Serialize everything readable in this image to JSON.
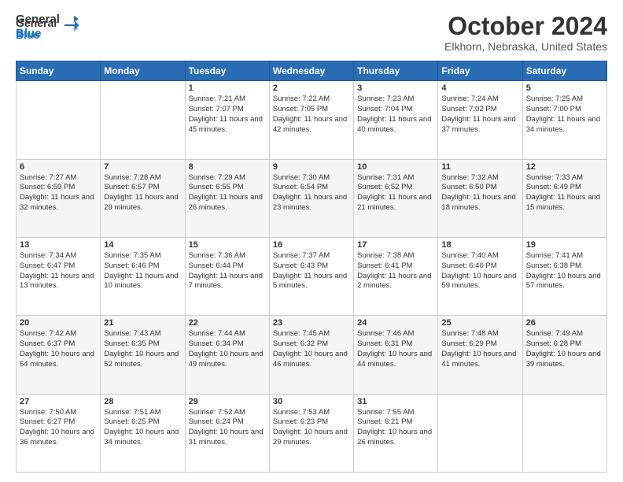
{
  "logo": {
    "line1": "General",
    "line2": "Blue"
  },
  "header": {
    "month": "October 2024",
    "location": "Elkhorn, Nebraska, United States"
  },
  "columns": [
    "Sunday",
    "Monday",
    "Tuesday",
    "Wednesday",
    "Thursday",
    "Friday",
    "Saturday"
  ],
  "weeks": [
    [
      {
        "day": "",
        "sunrise": "",
        "sunset": "",
        "daylight": ""
      },
      {
        "day": "",
        "sunrise": "",
        "sunset": "",
        "daylight": ""
      },
      {
        "day": "1",
        "sunrise": "Sunrise: 7:21 AM",
        "sunset": "Sunset: 7:07 PM",
        "daylight": "Daylight: 11 hours and 45 minutes."
      },
      {
        "day": "2",
        "sunrise": "Sunrise: 7:22 AM",
        "sunset": "Sunset: 7:05 PM",
        "daylight": "Daylight: 11 hours and 42 minutes."
      },
      {
        "day": "3",
        "sunrise": "Sunrise: 7:23 AM",
        "sunset": "Sunset: 7:04 PM",
        "daylight": "Daylight: 11 hours and 40 minutes."
      },
      {
        "day": "4",
        "sunrise": "Sunrise: 7:24 AM",
        "sunset": "Sunset: 7:02 PM",
        "daylight": "Daylight: 11 hours and 37 minutes."
      },
      {
        "day": "5",
        "sunrise": "Sunrise: 7:25 AM",
        "sunset": "Sunset: 7:00 PM",
        "daylight": "Daylight: 11 hours and 34 minutes."
      }
    ],
    [
      {
        "day": "6",
        "sunrise": "Sunrise: 7:27 AM",
        "sunset": "Sunset: 6:59 PM",
        "daylight": "Daylight: 11 hours and 32 minutes."
      },
      {
        "day": "7",
        "sunrise": "Sunrise: 7:28 AM",
        "sunset": "Sunset: 6:57 PM",
        "daylight": "Daylight: 11 hours and 29 minutes."
      },
      {
        "day": "8",
        "sunrise": "Sunrise: 7:29 AM",
        "sunset": "Sunset: 6:55 PM",
        "daylight": "Daylight: 11 hours and 26 minutes."
      },
      {
        "day": "9",
        "sunrise": "Sunrise: 7:30 AM",
        "sunset": "Sunset: 6:54 PM",
        "daylight": "Daylight: 11 hours and 23 minutes."
      },
      {
        "day": "10",
        "sunrise": "Sunrise: 7:31 AM",
        "sunset": "Sunset: 6:52 PM",
        "daylight": "Daylight: 11 hours and 21 minutes."
      },
      {
        "day": "11",
        "sunrise": "Sunrise: 7:32 AM",
        "sunset": "Sunset: 6:50 PM",
        "daylight": "Daylight: 11 hours and 18 minutes."
      },
      {
        "day": "12",
        "sunrise": "Sunrise: 7:33 AM",
        "sunset": "Sunset: 6:49 PM",
        "daylight": "Daylight: 11 hours and 15 minutes."
      }
    ],
    [
      {
        "day": "13",
        "sunrise": "Sunrise: 7:34 AM",
        "sunset": "Sunset: 6:47 PM",
        "daylight": "Daylight: 11 hours and 13 minutes."
      },
      {
        "day": "14",
        "sunrise": "Sunrise: 7:35 AM",
        "sunset": "Sunset: 6:46 PM",
        "daylight": "Daylight: 11 hours and 10 minutes."
      },
      {
        "day": "15",
        "sunrise": "Sunrise: 7:36 AM",
        "sunset": "Sunset: 6:44 PM",
        "daylight": "Daylight: 11 hours and 7 minutes."
      },
      {
        "day": "16",
        "sunrise": "Sunrise: 7:37 AM",
        "sunset": "Sunset: 6:43 PM",
        "daylight": "Daylight: 11 hours and 5 minutes."
      },
      {
        "day": "17",
        "sunrise": "Sunrise: 7:38 AM",
        "sunset": "Sunset: 6:41 PM",
        "daylight": "Daylight: 11 hours and 2 minutes."
      },
      {
        "day": "18",
        "sunrise": "Sunrise: 7:40 AM",
        "sunset": "Sunset: 6:40 PM",
        "daylight": "Daylight: 10 hours and 59 minutes."
      },
      {
        "day": "19",
        "sunrise": "Sunrise: 7:41 AM",
        "sunset": "Sunset: 6:38 PM",
        "daylight": "Daylight: 10 hours and 57 minutes."
      }
    ],
    [
      {
        "day": "20",
        "sunrise": "Sunrise: 7:42 AM",
        "sunset": "Sunset: 6:37 PM",
        "daylight": "Daylight: 10 hours and 54 minutes."
      },
      {
        "day": "21",
        "sunrise": "Sunrise: 7:43 AM",
        "sunset": "Sunset: 6:35 PM",
        "daylight": "Daylight: 10 hours and 52 minutes."
      },
      {
        "day": "22",
        "sunrise": "Sunrise: 7:44 AM",
        "sunset": "Sunset: 6:34 PM",
        "daylight": "Daylight: 10 hours and 49 minutes."
      },
      {
        "day": "23",
        "sunrise": "Sunrise: 7:45 AM",
        "sunset": "Sunset: 6:32 PM",
        "daylight": "Daylight: 10 hours and 46 minutes."
      },
      {
        "day": "24",
        "sunrise": "Sunrise: 7:46 AM",
        "sunset": "Sunset: 6:31 PM",
        "daylight": "Daylight: 10 hours and 44 minutes."
      },
      {
        "day": "25",
        "sunrise": "Sunrise: 7:48 AM",
        "sunset": "Sunset: 6:29 PM",
        "daylight": "Daylight: 10 hours and 41 minutes."
      },
      {
        "day": "26",
        "sunrise": "Sunrise: 7:49 AM",
        "sunset": "Sunset: 6:28 PM",
        "daylight": "Daylight: 10 hours and 39 minutes."
      }
    ],
    [
      {
        "day": "27",
        "sunrise": "Sunrise: 7:50 AM",
        "sunset": "Sunset: 6:27 PM",
        "daylight": "Daylight: 10 hours and 36 minutes."
      },
      {
        "day": "28",
        "sunrise": "Sunrise: 7:51 AM",
        "sunset": "Sunset: 6:25 PM",
        "daylight": "Daylight: 10 hours and 34 minutes."
      },
      {
        "day": "29",
        "sunrise": "Sunrise: 7:52 AM",
        "sunset": "Sunset: 6:24 PM",
        "daylight": "Daylight: 10 hours and 31 minutes."
      },
      {
        "day": "30",
        "sunrise": "Sunrise: 7:53 AM",
        "sunset": "Sunset: 6:23 PM",
        "daylight": "Daylight: 10 hours and 29 minutes."
      },
      {
        "day": "31",
        "sunrise": "Sunrise: 7:55 AM",
        "sunset": "Sunset: 6:21 PM",
        "daylight": "Daylight: 10 hours and 26 minutes."
      },
      {
        "day": "",
        "sunrise": "",
        "sunset": "",
        "daylight": ""
      },
      {
        "day": "",
        "sunrise": "",
        "sunset": "",
        "daylight": ""
      }
    ]
  ]
}
